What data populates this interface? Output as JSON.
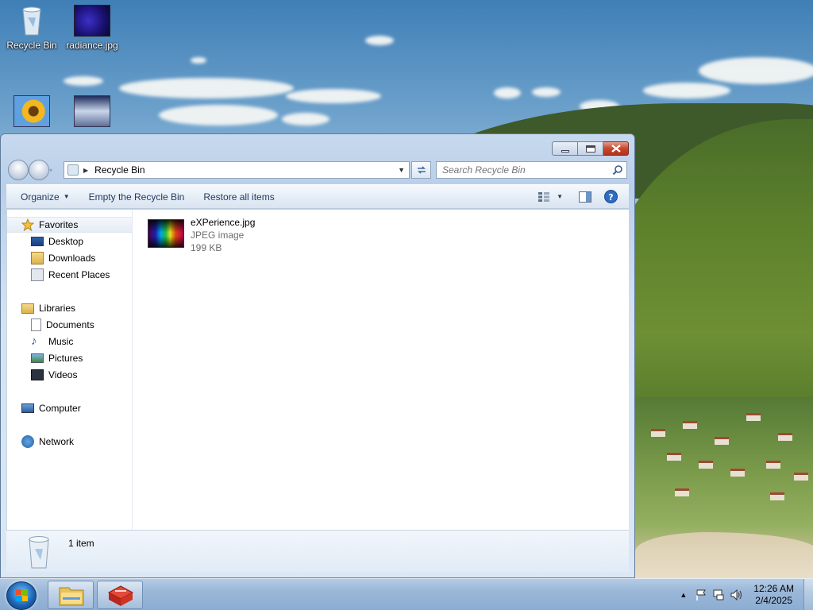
{
  "desktop": {
    "icons": [
      {
        "label": "Recycle Bin"
      },
      {
        "label": "radiance.jpg"
      }
    ]
  },
  "window": {
    "address": {
      "crumb": "Recycle Bin"
    },
    "search": {
      "placeholder": "Search Recycle Bin"
    },
    "commands": {
      "organize": "Organize",
      "empty": "Empty the Recycle Bin",
      "restore": "Restore all items"
    },
    "nav": {
      "favorites": "Favorites",
      "desktop": "Desktop",
      "downloads": "Downloads",
      "recent": "Recent Places",
      "libraries": "Libraries",
      "documents": "Documents",
      "music": "Music",
      "pictures": "Pictures",
      "videos": "Videos",
      "computer": "Computer",
      "network": "Network"
    },
    "file": {
      "name": "eXPerience.jpg",
      "type": "JPEG image",
      "size": "199 KB"
    },
    "details": {
      "count": "1 item"
    }
  },
  "taskbar": {
    "clock_time": "12:26 AM",
    "clock_date": "2/4/2025"
  },
  "colors": {
    "close_button": "#c6472f",
    "command_text": "#1e395b",
    "taskbar": "#9ab7d8"
  }
}
